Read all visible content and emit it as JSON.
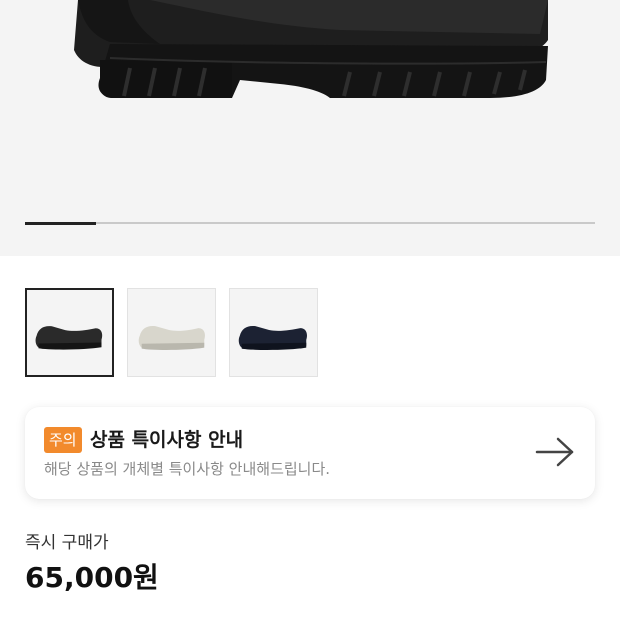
{
  "gallery": {
    "progress_fraction": 0.125,
    "selected_index": 0,
    "thumbnails": [
      {
        "color": "#2a2a2a",
        "name": "black"
      },
      {
        "color": "#d8d6cc",
        "name": "white"
      },
      {
        "color": "#1c2233",
        "name": "navy"
      }
    ]
  },
  "notice": {
    "badge": "주의",
    "title": "상품 특이사항 안내",
    "description": "해당 상품의 개체별 특이사항 안내해드립니다.",
    "arrow_icon": "arrow-right-icon",
    "badge_color": "#f28a2c"
  },
  "price": {
    "label": "즉시 구매가",
    "value": "65,000원"
  }
}
